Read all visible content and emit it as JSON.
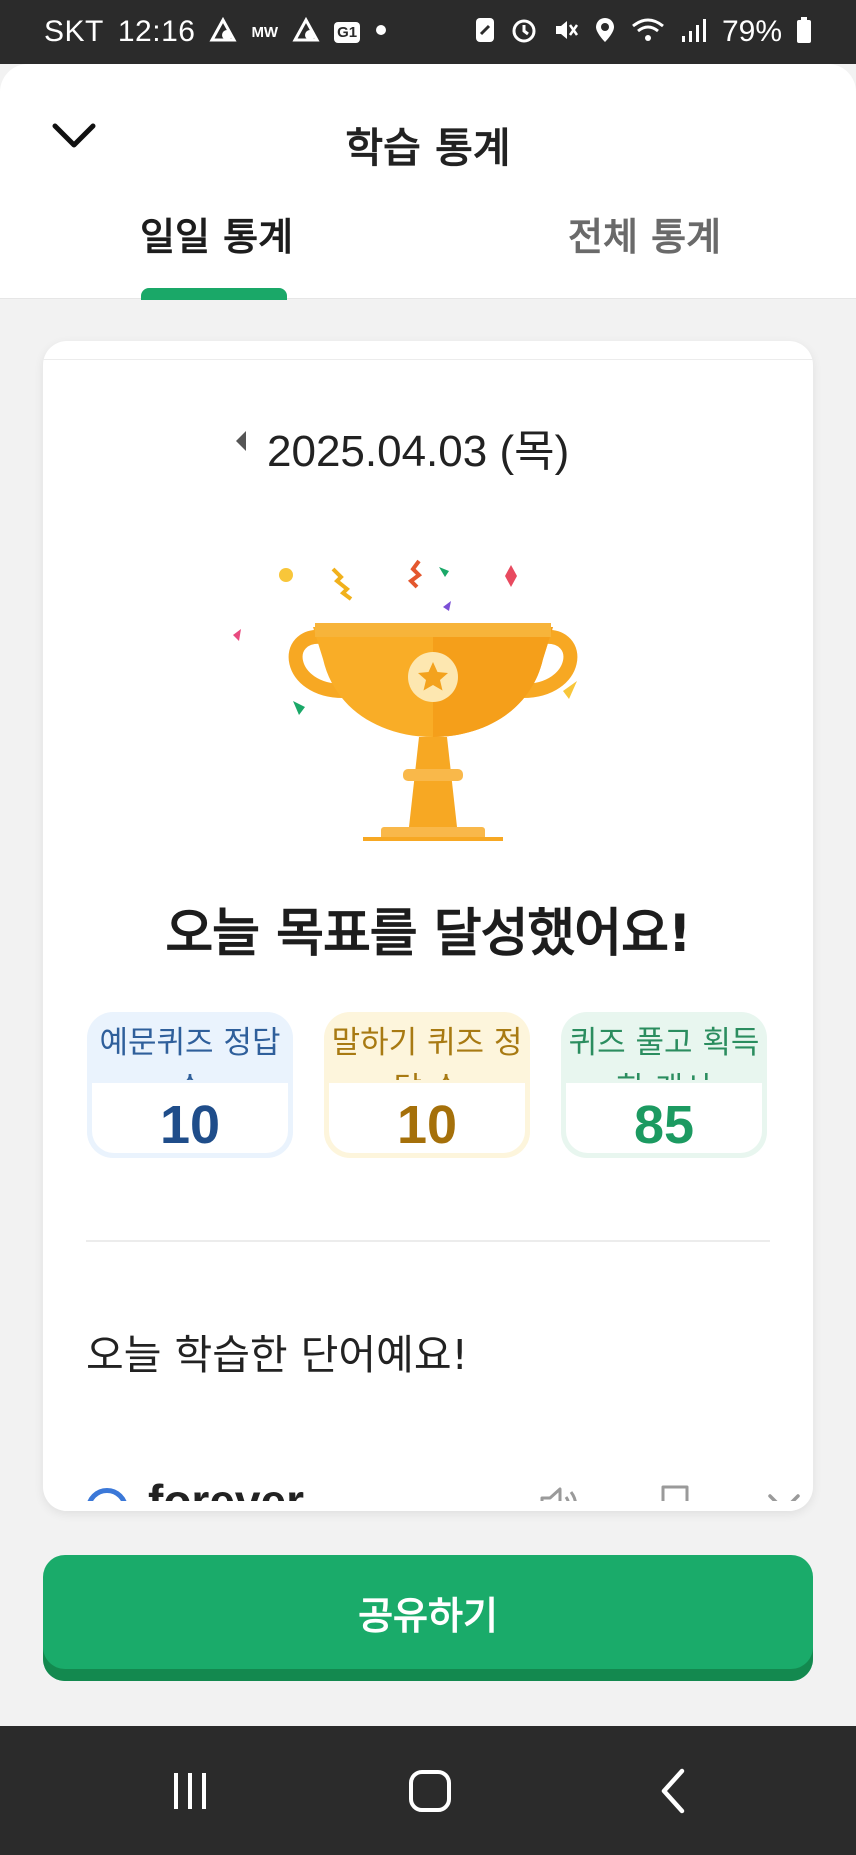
{
  "status_bar": {
    "carrier": "SKT",
    "time": "12:16",
    "notif_label": "MW",
    "notif_badge": "G1",
    "battery": "79%"
  },
  "header": {
    "title": "학습 통계",
    "tabs": [
      {
        "label": "일일 통계",
        "active": true
      },
      {
        "label": "전체 통계",
        "active": false
      }
    ]
  },
  "card": {
    "date": "2025.04.03 (목)",
    "achievement": "오늘 목표를 달성했어요!",
    "stats": [
      {
        "label": "예문퀴즈 정답 수",
        "value": "10"
      },
      {
        "label": "말하기 퀴즈 정답 수",
        "value": "10"
      },
      {
        "label": "퀴즈 풀고 획득한 캐시",
        "value": "85"
      }
    ],
    "section_title": "오늘 학습한 단어예요!",
    "words": [
      {
        "word": "forever"
      }
    ]
  },
  "share_button": "공유하기",
  "colors": {
    "accent": "#1aab6a",
    "trophy": "#f7a823"
  }
}
